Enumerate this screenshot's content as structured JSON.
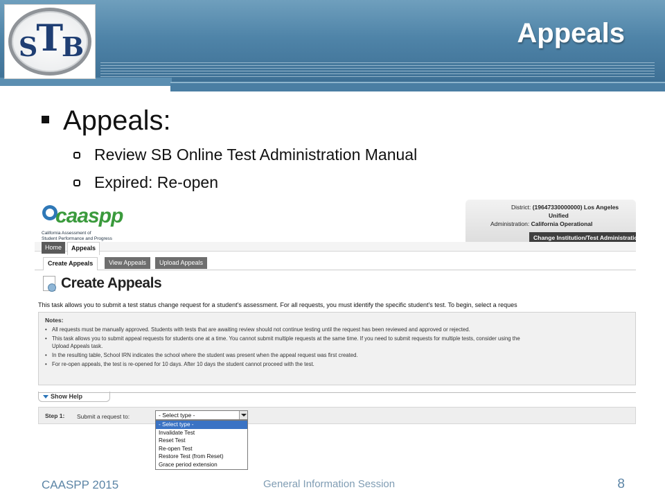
{
  "slide": {
    "title": "Appeals",
    "logo_text": "STB",
    "bullet_main": "Appeals:",
    "sub_bullets": [
      "Review SB Online Test Administration Manual",
      "Expired: Re-open"
    ],
    "footer_left": "CAASPP 2015",
    "footer_center": "General Information Session",
    "page_number": "8",
    "colors": {
      "header_blue": "#4f84a8",
      "footer_text": "#5c85a6"
    }
  },
  "screenshot": {
    "logo_word": "caaspp",
    "logo_subtitle_1": "California Assessment of",
    "logo_subtitle_2": "Student Performance and Progress",
    "district_label": "District:",
    "district_value": "(19647330000000) Los Angeles",
    "district_value_2": "Unified",
    "admin_label": "Administration:",
    "admin_value": "California Operational",
    "change_button": "Change Institution/Test Administration",
    "nav_tabs": [
      "Home",
      "Appeals"
    ],
    "sub_tabs": [
      "Create Appeals",
      "View Appeals",
      "Upload Appeals"
    ],
    "page_heading": "Create Appeals",
    "intro_text": "This task allows you to submit a test status change request for a student's assessment. For all requests, you must identify the specific student's test. To begin, select a reques",
    "notes_heading": "Notes:",
    "notes": [
      "All requests must be manually approved. Students with tests that are awaiting review should not continue testing until the request has been reviewed and approved or rejected.",
      "This task allows you to submit appeal requests for students one at a time. You cannot submit multiple requests at the same time. If you need to submit requests for multiple tests, consider using the",
      "Upload Appeals task.",
      "In the resulting table, School IRN indicates the school where the student was present when the appeal request was first created.",
      "For re-open appeals, the test is re-opened for 10 days. After 10 days the student cannot proceed with the test."
    ],
    "show_help": "Show Help",
    "step_label": "Step 1:",
    "step_text": "Submit a request to:",
    "select_value": "- Select type -",
    "dropdown_options": [
      "- Select type -",
      "Invalidate Test",
      "Reset Test",
      "Re-open Test",
      "Restore Test (from Reset)",
      "Grace period extension"
    ]
  }
}
